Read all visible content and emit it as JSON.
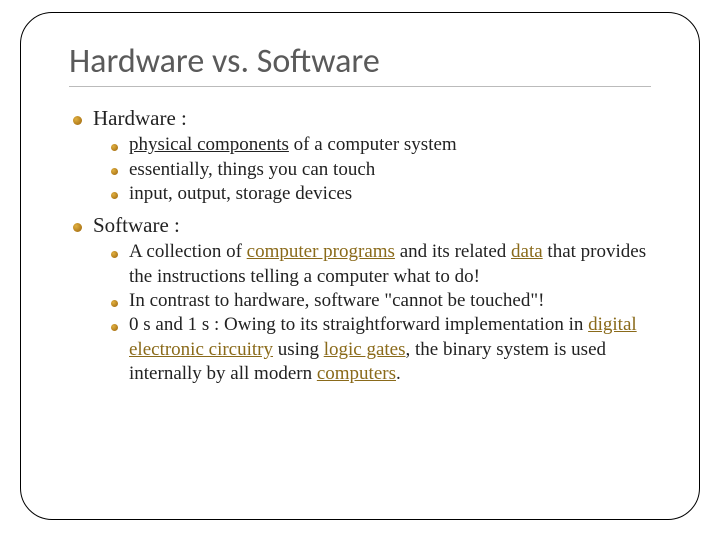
{
  "title": "Hardware vs. Software",
  "sections": [
    {
      "heading": "Hardware :",
      "items": [
        {
          "runs": [
            {
              "t": "physical components",
              "cls": "u"
            },
            {
              "t": " of a computer system"
            }
          ]
        },
        {
          "runs": [
            {
              "t": "essentially, things you can touch"
            }
          ]
        },
        {
          "runs": [
            {
              "t": "input, output, storage devices"
            }
          ]
        }
      ]
    },
    {
      "heading": "Software :",
      "items": [
        {
          "runs": [
            {
              "t": "A collection of "
            },
            {
              "t": "computer programs",
              "cls": "link"
            },
            {
              "t": " and its related "
            },
            {
              "t": "data",
              "cls": "link"
            },
            {
              "t": " that provides the instructions telling a computer what to do!"
            }
          ]
        },
        {
          "runs": [
            {
              "t": "In contrast to hardware, software \"cannot be touched\"!"
            }
          ]
        },
        {
          "runs": [
            {
              "t": "0 s and 1 s : Owing to its straightforward implementation in "
            },
            {
              "t": "digital",
              "cls": "link"
            },
            {
              "t": " "
            },
            {
              "t": "electronic circuitry",
              "cls": "link"
            },
            {
              "t": " using "
            },
            {
              "t": "logic gates",
              "cls": "link"
            },
            {
              "t": ", the binary system is used internally by all modern "
            },
            {
              "t": "computers",
              "cls": "link"
            },
            {
              "t": "."
            }
          ]
        }
      ]
    }
  ]
}
